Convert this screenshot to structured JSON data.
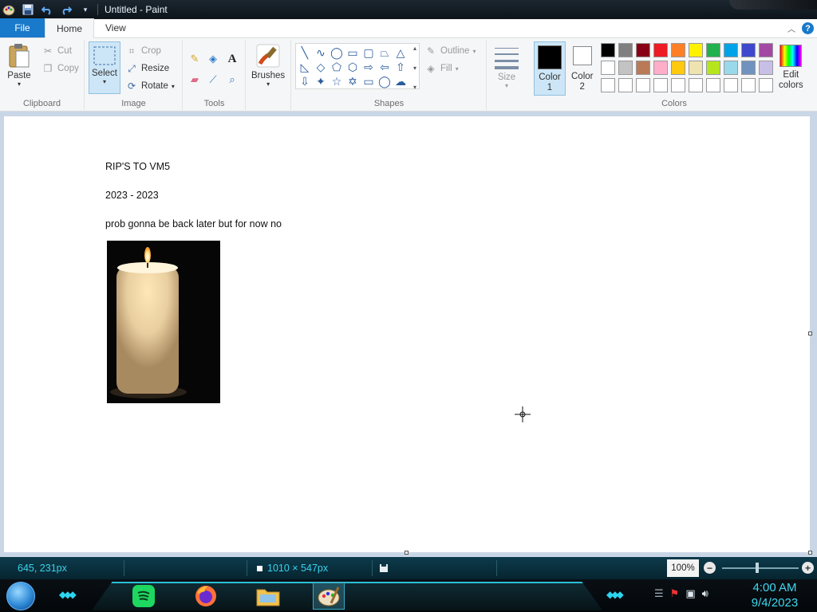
{
  "window": {
    "title": "Untitled - Paint"
  },
  "tabs": {
    "file": "File",
    "home": "Home",
    "view": "View"
  },
  "clipboard": {
    "paste": "Paste",
    "cut": "Cut",
    "copy": "Copy",
    "label": "Clipboard"
  },
  "image": {
    "select": "Select",
    "crop": "Crop",
    "resize": "Resize",
    "rotate": "Rotate",
    "label": "Image"
  },
  "tools": {
    "label": "Tools"
  },
  "brushes": {
    "label": "Brushes"
  },
  "shapes": {
    "outline": "Outline",
    "fill": "Fill",
    "label": "Shapes"
  },
  "size": {
    "label": "Size"
  },
  "colors": {
    "color1_line1": "Color",
    "color1_line2": "1",
    "color2_line1": "Color",
    "color2_line2": "2",
    "edit_line1": "Edit",
    "edit_line2": "colors",
    "label": "Colors",
    "color1": "#000000",
    "color2": "#ffffff",
    "palette_row1": [
      "#000000",
      "#7f7f7f",
      "#880015",
      "#ed1c24",
      "#ff7f27",
      "#fff200",
      "#22b14c",
      "#00a2e8",
      "#3f48cc",
      "#a349a4"
    ],
    "palette_row2": [
      "#ffffff",
      "#c3c3c3",
      "#b97a57",
      "#ffaec9",
      "#ffc90e",
      "#efe4b0",
      "#b5e61d",
      "#99d9ea",
      "#7092be",
      "#c8bfe7"
    ],
    "palette_row3": [
      "#ffffff",
      "#ffffff",
      "#ffffff",
      "#ffffff",
      "#ffffff",
      "#ffffff",
      "#ffffff",
      "#ffffff",
      "#ffffff",
      "#ffffff"
    ]
  },
  "canvas": {
    "line1": "RIP'S TO VM5",
    "line2": "2023 - 2023",
    "line3": "prob gonna be back later but for now no"
  },
  "status": {
    "cursor_pos": "645, 231px",
    "canvas_size": "1010 × 547px",
    "zoom": "100%"
  },
  "taskbar": {
    "time": "4:00 AM",
    "date": "9/4/2023",
    "apps": [
      "spotify-icon",
      "firefox-icon",
      "file-explorer-icon",
      "paint-icon"
    ]
  }
}
